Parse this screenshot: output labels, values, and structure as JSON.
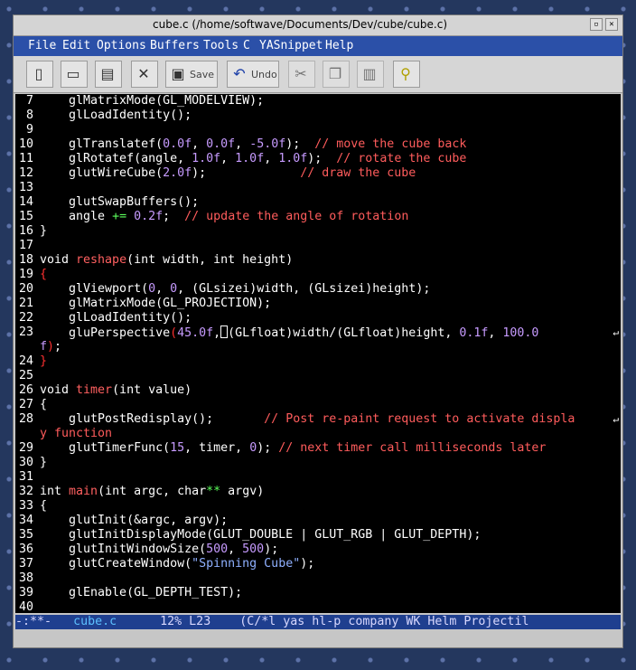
{
  "window": {
    "title": "cube.c (/home/softwave/Documents/Dev/cube/cube.c)"
  },
  "menu": [
    "File",
    "Edit",
    "Options",
    "Buffers",
    "Tools",
    "C",
    "YASnippet",
    "Help"
  ],
  "toolbar": {
    "save_label": "Save",
    "undo_label": "Undo"
  },
  "code_lines": [
    {
      "n": "7",
      "html": "    glMatrixMode(GL_MODELVIEW);"
    },
    {
      "n": "8",
      "html": "    glLoadIdentity();"
    },
    {
      "n": "9",
      "html": ""
    },
    {
      "n": "10",
      "html": "    glTranslatef(<span class='num'>0.0f</span>, <span class='num'>0.0f</span>, <span class='num'>-5.0f</span>);  <span class='com'>// move the cube back</span>"
    },
    {
      "n": "11",
      "html": "    glRotatef(angle, <span class='num'>1.0f</span>, <span class='num'>1.0f</span>, <span class='num'>1.0f</span>);  <span class='com'>// rotate the cube</span>"
    },
    {
      "n": "12",
      "html": "    glutWireCube(<span class='num'>2.0f</span>);             <span class='com'>// draw the cube</span>"
    },
    {
      "n": "13",
      "html": ""
    },
    {
      "n": "14",
      "html": "    glutSwapBuffers();"
    },
    {
      "n": "15",
      "html": "    angle <span class='op'>+=</span> <span class='num'>0.2f</span>;  <span class='com'>// update the angle of rotation</span>"
    },
    {
      "n": "16",
      "html": "}"
    },
    {
      "n": "17",
      "html": ""
    },
    {
      "n": "18",
      "html": "void <span class='fn'>reshape</span>(int width, int height)"
    },
    {
      "n": "19",
      "html": "<span class='brace'>{</span>"
    },
    {
      "n": "20",
      "html": "    glViewport(<span class='num'>0</span>, <span class='num'>0</span>, (GLsizei)width, (GLsizei)height);"
    },
    {
      "n": "21",
      "html": "    glMatrixMode(GL_PROJECTION);"
    },
    {
      "n": "22",
      "html": "    glLoadIdentity();"
    },
    {
      "n": "23",
      "html": "    gluPerspective<span class='brace'>(</span><span class='num'>45.0f</span>,<span class='cursor'></span>(GLfloat)width/(GLfloat)height, <span class='num'>0.1f</span>, <span class='num'>100.0</span>",
      "wrap": true
    },
    {
      "n": "",
      "html": "<span class='num'>f</span><span class='brace'>)</span>;"
    },
    {
      "n": "24",
      "html": "<span class='brace'>}</span>"
    },
    {
      "n": "25",
      "html": ""
    },
    {
      "n": "26",
      "html": "void <span class='fn'>timer</span>(int value)"
    },
    {
      "n": "27",
      "html": "{"
    },
    {
      "n": "28",
      "html": "    glutPostRedisplay();       <span class='com'>// Post re-paint request to activate displa</span>",
      "wrap": true
    },
    {
      "n": "",
      "html": "<span class='com'>y function</span>"
    },
    {
      "n": "29",
      "html": "    glutTimerFunc(<span class='num'>15</span>, timer, <span class='num'>0</span>); <span class='com'>// next timer call milliseconds later</span>"
    },
    {
      "n": "30",
      "html": "}"
    },
    {
      "n": "31",
      "html": ""
    },
    {
      "n": "32",
      "html": "int <span class='fn'>main</span>(int argc, char<span class='op'>**</span> argv)"
    },
    {
      "n": "33",
      "html": "{"
    },
    {
      "n": "34",
      "html": "    glutInit(&amp;argc, argv);"
    },
    {
      "n": "35",
      "html": "    glutInitDisplayMode(GLUT_DOUBLE | GLUT_RGB | GLUT_DEPTH);"
    },
    {
      "n": "36",
      "html": "    glutInitWindowSize(<span class='num'>500</span>, <span class='num'>500</span>);"
    },
    {
      "n": "37",
      "html": "    glutCreateWindow(<span class='str'>\"Spinning Cube\"</span>);"
    },
    {
      "n": "38",
      "html": ""
    },
    {
      "n": "39",
      "html": "    glEnable(GL_DEPTH_TEST);"
    },
    {
      "n": "40",
      "html": ""
    }
  ],
  "modeline": {
    "status": "-:**-",
    "buffer": "cube.c",
    "position": "12% L23",
    "modes": "(C/*l yas hl-p company WK Helm Projectil"
  }
}
